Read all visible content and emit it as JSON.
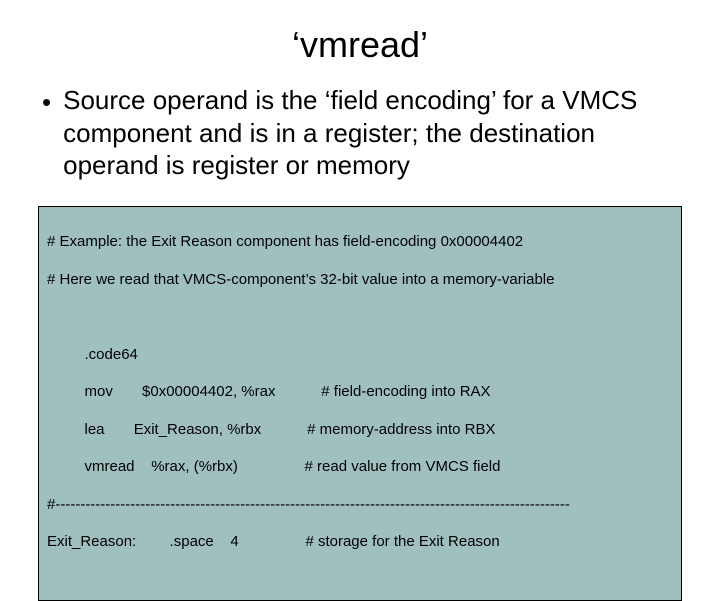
{
  "title": "‘vmread’",
  "bullet": "Source operand is the ‘field encoding’ for a VMCS component and is in a register; the destination operand is register or memory",
  "code": {
    "c1": "# Example: the Exit Reason component has field-encoding 0x00004402",
    "c2": "# Here we read that VMCS-component’s 32-bit value into a memory-variable",
    "blank1": " ",
    "l1a": "         .code64",
    "l2a": "         mov       $0x00004402, %rax           # field-encoding into RAX",
    "l3a": "         lea       Exit_Reason, %rbx           # memory-address into RBX",
    "l4a": "         vmread    %rax, (%rbx)                # read value from VMCS field",
    "dash": "#-------------------------------------------------------------------------------------------------------",
    "l5a": "Exit_Reason:        .space    4                # storage for the Exit Reason"
  }
}
